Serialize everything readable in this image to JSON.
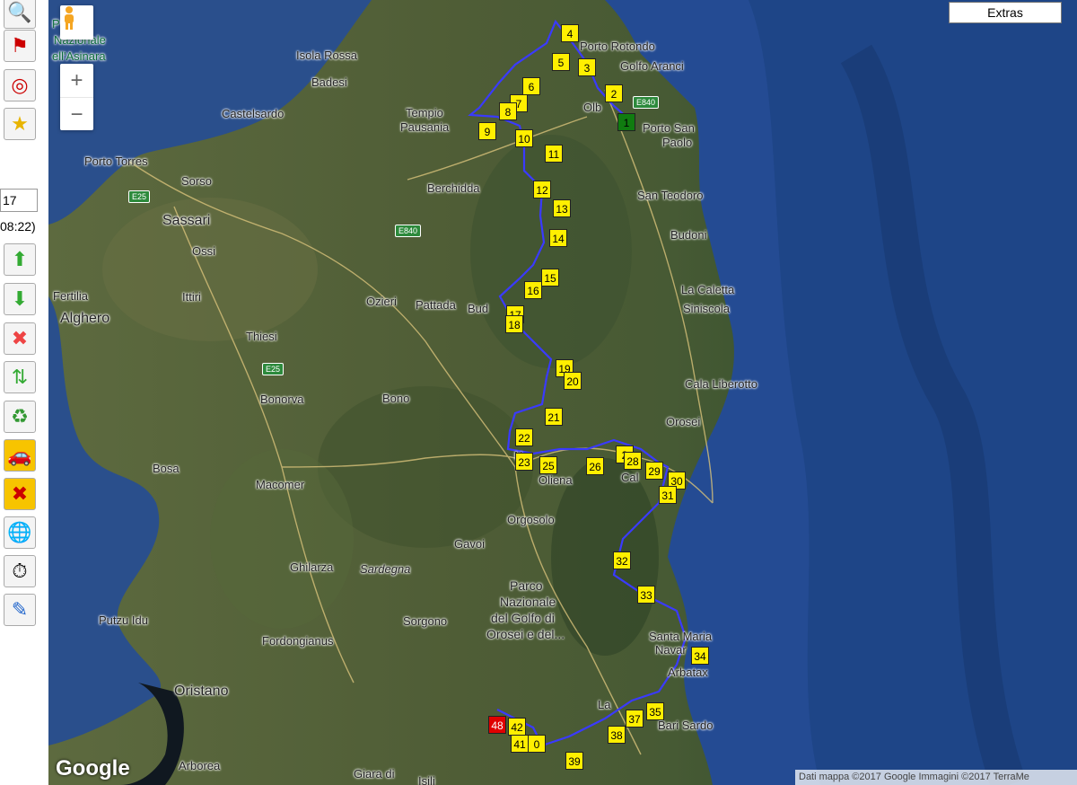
{
  "toolbar": {
    "buttons": [
      {
        "name": "search",
        "glyph": "🔍"
      },
      {
        "name": "flag",
        "glyph": "⚑"
      },
      {
        "name": "target",
        "glyph": "◎"
      },
      {
        "name": "favorite",
        "glyph": "★"
      }
    ],
    "field_value": "17",
    "time_text": "08:22)",
    "buttons2": [
      {
        "name": "move-up",
        "glyph": "⬆"
      },
      {
        "name": "move-down",
        "glyph": "⬇"
      },
      {
        "name": "delete",
        "glyph": "✖"
      },
      {
        "name": "reverse",
        "glyph": "⇅"
      },
      {
        "name": "recycle",
        "glyph": "♻"
      },
      {
        "name": "car",
        "glyph": "🚗"
      },
      {
        "name": "cancel",
        "glyph": "✖"
      },
      {
        "name": "globe",
        "glyph": "🌐"
      },
      {
        "name": "stopwatch",
        "glyph": "⏱"
      },
      {
        "name": "edit",
        "glyph": "✎"
      }
    ]
  },
  "map": {
    "extras_label": "Extras",
    "zoom_in": "+",
    "zoom_out": "−",
    "google_logo": "Google",
    "attribution": "Dati mappa ©2017 Google Immagini ©2017 TerraMe",
    "places": [
      {
        "t": "Isola Rossa",
        "c": "isola-rossa"
      },
      {
        "t": "Badesi",
        "c": "badesi"
      },
      {
        "t": "Castelsardo",
        "c": "castelsardo"
      },
      {
        "t": "Tempio",
        "c": "tempio"
      },
      {
        "t": "Pausania",
        "c": "pausania"
      },
      {
        "t": "Porto Rotondo",
        "c": "porto-rotondo"
      },
      {
        "t": "Golfo Aranci",
        "c": "golfo-aranci"
      },
      {
        "t": "Olb",
        "c": "olbia"
      },
      {
        "t": "Porto San",
        "c": "porto-san"
      },
      {
        "t": "Paolo",
        "c": "paolo"
      },
      {
        "t": "Porto Torres",
        "c": "porto-torres"
      },
      {
        "t": "Sorso",
        "c": "sorso"
      },
      {
        "t": "Sassari",
        "c": "sassari"
      },
      {
        "t": "Ossi",
        "c": "ossi"
      },
      {
        "t": "Berchidda",
        "c": "berchidda"
      },
      {
        "t": "San Teodoro",
        "c": "san-teodoro"
      },
      {
        "t": "Budoni",
        "c": "budoni"
      },
      {
        "t": "Fertilia",
        "c": "fertilia"
      },
      {
        "t": "Alghero",
        "c": "alghero"
      },
      {
        "t": "Ittiri",
        "c": "ittiri"
      },
      {
        "t": "Ozieri",
        "c": "ozieri"
      },
      {
        "t": "Pattada",
        "c": "pattada"
      },
      {
        "t": "Bud",
        "c": "bud"
      },
      {
        "t": "La Caletta",
        "c": "la-caletta"
      },
      {
        "t": "Siniscola",
        "c": "siniscola"
      },
      {
        "t": "Thiesi",
        "c": "thiesi"
      },
      {
        "t": "Bonorva",
        "c": "bonorva"
      },
      {
        "t": "Bono",
        "c": "bono"
      },
      {
        "t": "Cala Liberotto",
        "c": "cala-liberotto"
      },
      {
        "t": "Orosei",
        "c": "orosei"
      },
      {
        "t": "Bosa",
        "c": "bosa"
      },
      {
        "t": "Macomer",
        "c": "macomer"
      },
      {
        "t": "Oliena",
        "c": "oliena"
      },
      {
        "t": "Orgosolo",
        "c": "orgosolo"
      },
      {
        "t": "Gavoi",
        "c": "gavoi"
      },
      {
        "t": "Ghilarza",
        "c": "ghilarza"
      },
      {
        "t": "Sardegna",
        "c": "sardegna"
      },
      {
        "t": "Parco",
        "c": "parco"
      },
      {
        "t": "Nazionale",
        "c": "nazionale"
      },
      {
        "t": "del Golfo di",
        "c": "del-golfo"
      },
      {
        "t": "Orosei e del...",
        "c": "orosei-e-del"
      },
      {
        "t": "Putzu Idu",
        "c": "putzu-idu"
      },
      {
        "t": "Sorgono",
        "c": "sorgono"
      },
      {
        "t": "Santa Maria",
        "c": "santa-maria"
      },
      {
        "t": "Navar",
        "c": "navar"
      },
      {
        "t": "Arbatax",
        "c": "arbatax"
      },
      {
        "t": "Fordongianus",
        "c": "fordongianus"
      },
      {
        "t": "Oristano",
        "c": "oristano"
      },
      {
        "t": "Bari Sardo",
        "c": "bari-sardo"
      },
      {
        "t": "Arborea",
        "c": "arborea"
      },
      {
        "t": "Giara di",
        "c": "giara-di"
      },
      {
        "t": "Nazionale",
        "c": "asinara-1"
      },
      {
        "t": "ell'Asinara",
        "c": "asinara-2"
      },
      {
        "t": "P",
        "c": "asinara-0"
      },
      {
        "t": "Cal",
        "c": "cal"
      },
      {
        "t": "N",
        "c": "n-nuoro"
      },
      {
        "t": "La",
        "c": "la-lanusei"
      },
      {
        "t": "Isili",
        "c": "isili"
      }
    ],
    "roads": [
      {
        "t": "E840",
        "c": "e840-a"
      },
      {
        "t": "E25",
        "c": "e25-a"
      },
      {
        "t": "E840",
        "c": "e840-b"
      },
      {
        "t": "E25",
        "c": "e25-b"
      }
    ],
    "markers": [
      "1",
      "2",
      "3",
      "4",
      "5",
      "6",
      "7",
      "8",
      "9",
      "10",
      "11",
      "12",
      "13",
      "14",
      "15",
      "16",
      "17",
      "18",
      "19",
      "20",
      "21",
      "22",
      "23",
      "25",
      "26",
      "2",
      "28",
      "29",
      "30",
      "31",
      "32",
      "33",
      "34",
      "35",
      "37",
      "38",
      "39",
      "41",
      "0",
      "42",
      "48"
    ]
  }
}
